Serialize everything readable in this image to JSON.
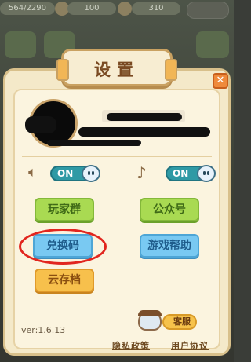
{
  "hud": {
    "diamonds": "564/2290",
    "coins": "100",
    "stars": "310"
  },
  "dialog": {
    "title": "设置",
    "close_label": "✕"
  },
  "toggles": {
    "sound": {
      "icon": "speaker-icon",
      "label": "ON",
      "on": true
    },
    "music": {
      "icon": "music-note-icon",
      "label": "ON",
      "on": true
    }
  },
  "menu": {
    "player_group": "玩家群",
    "official_account": "公众号",
    "redeem_code": "兑换码",
    "game_help": "游戏帮助",
    "cloud_save": "云存档"
  },
  "footer": {
    "version": "ver:1.6.13",
    "customer_service": "客服",
    "privacy_policy": "隐私政策",
    "user_agreement": "用户协议"
  },
  "colors": {
    "toggle_on": "#2f9aa5",
    "green_button": "#a9da52",
    "blue_button": "#79c9f2",
    "orange_button": "#f7c04c",
    "highlight_circle": "#e1261f"
  }
}
